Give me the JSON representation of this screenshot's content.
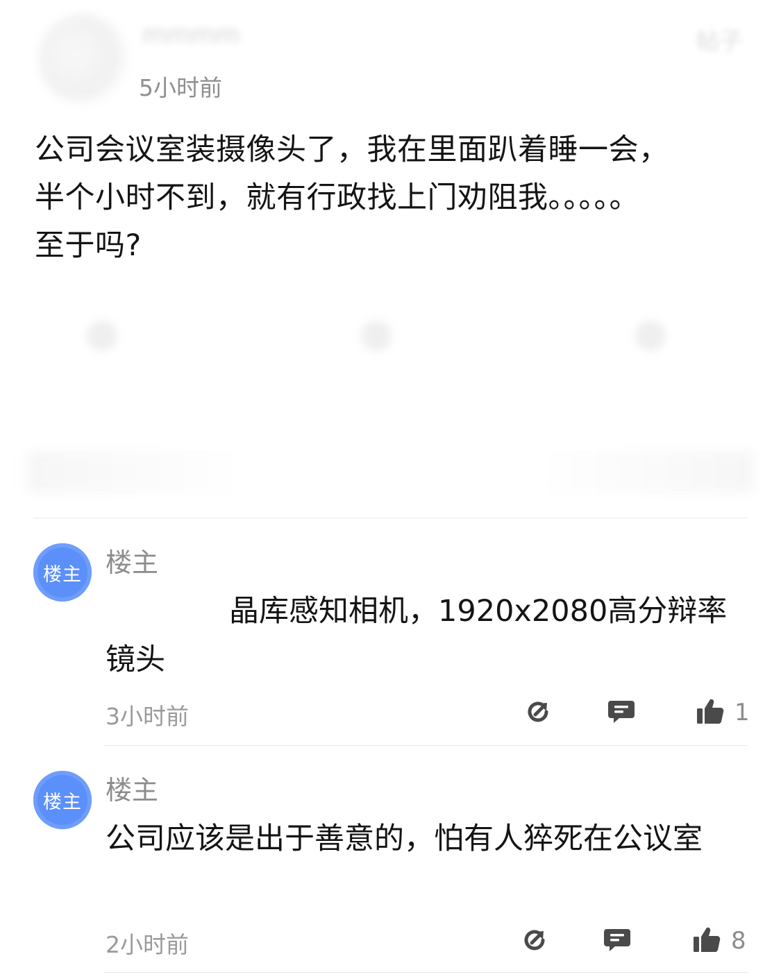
{
  "post": {
    "author": "mmmm",
    "link_text": "帖子",
    "time": "5小时前",
    "body": "公司会议室装摄像头了，我在里面趴着睡一会，\n半个小时不到，就有行政找上门劝阻我。。。。。\n至于吗?"
  },
  "comments": [
    {
      "avatar_text": "楼主",
      "author": "楼主",
      "text_before_redaction": "",
      "text": "晶库感知相机，1920x2080高分辩率镜头",
      "time": "3小时前",
      "likes": "1"
    },
    {
      "avatar_text": "楼主",
      "author": "楼主",
      "text": "公司应该是出于善意的，怕有人猝死在公议室",
      "time": "2小时前",
      "likes": "8"
    }
  ],
  "icons": {
    "share": "share-icon",
    "reply": "reply-icon",
    "like": "thumbs-up-icon"
  },
  "colors": {
    "avatar": "#5b8ff9",
    "icon": "#4a4a4a",
    "meta_text": "#9a9a9a"
  }
}
